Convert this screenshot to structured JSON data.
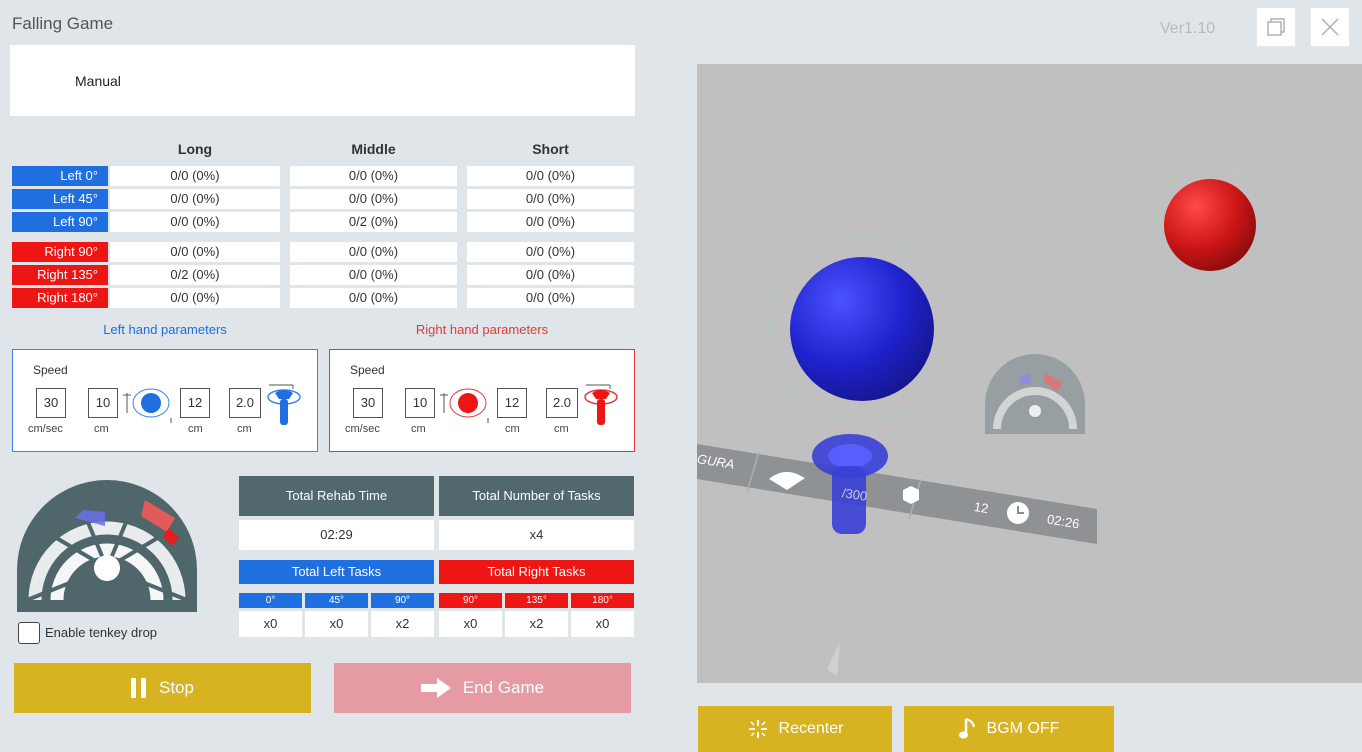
{
  "app": {
    "title": "Falling Game",
    "version": "Ver1.10"
  },
  "mode": {
    "label": "Manual"
  },
  "table": {
    "columns": [
      "Long",
      "Middle",
      "Short"
    ],
    "left_rows": [
      {
        "label": "Left 0°",
        "values": [
          "0/0 (0%)",
          "0/0 (0%)",
          "0/0 (0%)"
        ]
      },
      {
        "label": "Left 45°",
        "values": [
          "0/0 (0%)",
          "0/0 (0%)",
          "0/0 (0%)"
        ]
      },
      {
        "label": "Left 90°",
        "values": [
          "0/0 (0%)",
          "0/2 (0%)",
          "0/0 (0%)"
        ]
      }
    ],
    "right_rows": [
      {
        "label": "Right 90°",
        "values": [
          "0/0 (0%)",
          "0/0 (0%)",
          "0/0 (0%)"
        ]
      },
      {
        "label": "Right 135°",
        "values": [
          "0/2 (0%)",
          "0/0 (0%)",
          "0/0 (0%)"
        ]
      },
      {
        "label": "Right 180°",
        "values": [
          "0/0 (0%)",
          "0/0 (0%)",
          "0/0 (0%)"
        ]
      }
    ]
  },
  "left_params": {
    "title": "Left hand parameters",
    "speed_label": "Speed",
    "speed": "30",
    "speed_unit": "cm/sec",
    "dist1": "10",
    "dist1_unit": "cm",
    "dist2": "12",
    "dist2_unit": "cm",
    "dist3": "2.0",
    "dist3_unit": "cm"
  },
  "right_params": {
    "title": "Right hand parameters",
    "speed_label": "Speed",
    "speed": "30",
    "speed_unit": "cm/sec",
    "dist1": "10",
    "dist1_unit": "cm",
    "dist2": "12",
    "dist2_unit": "cm",
    "dist3": "2.0",
    "dist3_unit": "cm"
  },
  "stats": {
    "rehab_time_label": "Total Rehab Time",
    "rehab_time": "02:29",
    "tasks_label": "Total Number of Tasks",
    "tasks": "x4",
    "left_tasks_label": "Total Left Tasks",
    "right_tasks_label": "Total Right Tasks",
    "left_angles": [
      {
        "angle": "0°",
        "count": "x0"
      },
      {
        "angle": "45°",
        "count": "x0"
      },
      {
        "angle": "90°",
        "count": "x2"
      }
    ],
    "right_angles": [
      {
        "angle": "90°",
        "count": "x0"
      },
      {
        "angle": "135°",
        "count": "x2"
      },
      {
        "angle": "180°",
        "count": "x0"
      }
    ]
  },
  "tenkey": {
    "label": "Enable tenkey drop",
    "checked": false
  },
  "buttons": {
    "stop": "Stop",
    "end_game": "End Game",
    "recenter": "Recenter",
    "bgm": "BGM OFF"
  },
  "viewport": {
    "brand": "GURA",
    "score": "/300",
    "cubes": "12",
    "timer": "02:26"
  },
  "colors": {
    "left": "#1f6fe0",
    "right": "#ee1515",
    "accent": "#d7b221",
    "end_game": "#e69aa3",
    "stats_header": "#50686e"
  }
}
